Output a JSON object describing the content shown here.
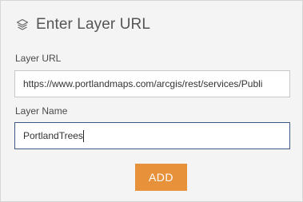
{
  "header": {
    "icon": "layers-icon",
    "title": "Enter Layer URL"
  },
  "form": {
    "layer_url": {
      "label": "Layer URL",
      "value": "https://www.portlandmaps.com/arcgis/rest/services/Publi"
    },
    "layer_name": {
      "label": "Layer Name",
      "value": "PortlandTrees"
    }
  },
  "actions": {
    "add_label": "ADD",
    "add_color": "#e8913b"
  }
}
